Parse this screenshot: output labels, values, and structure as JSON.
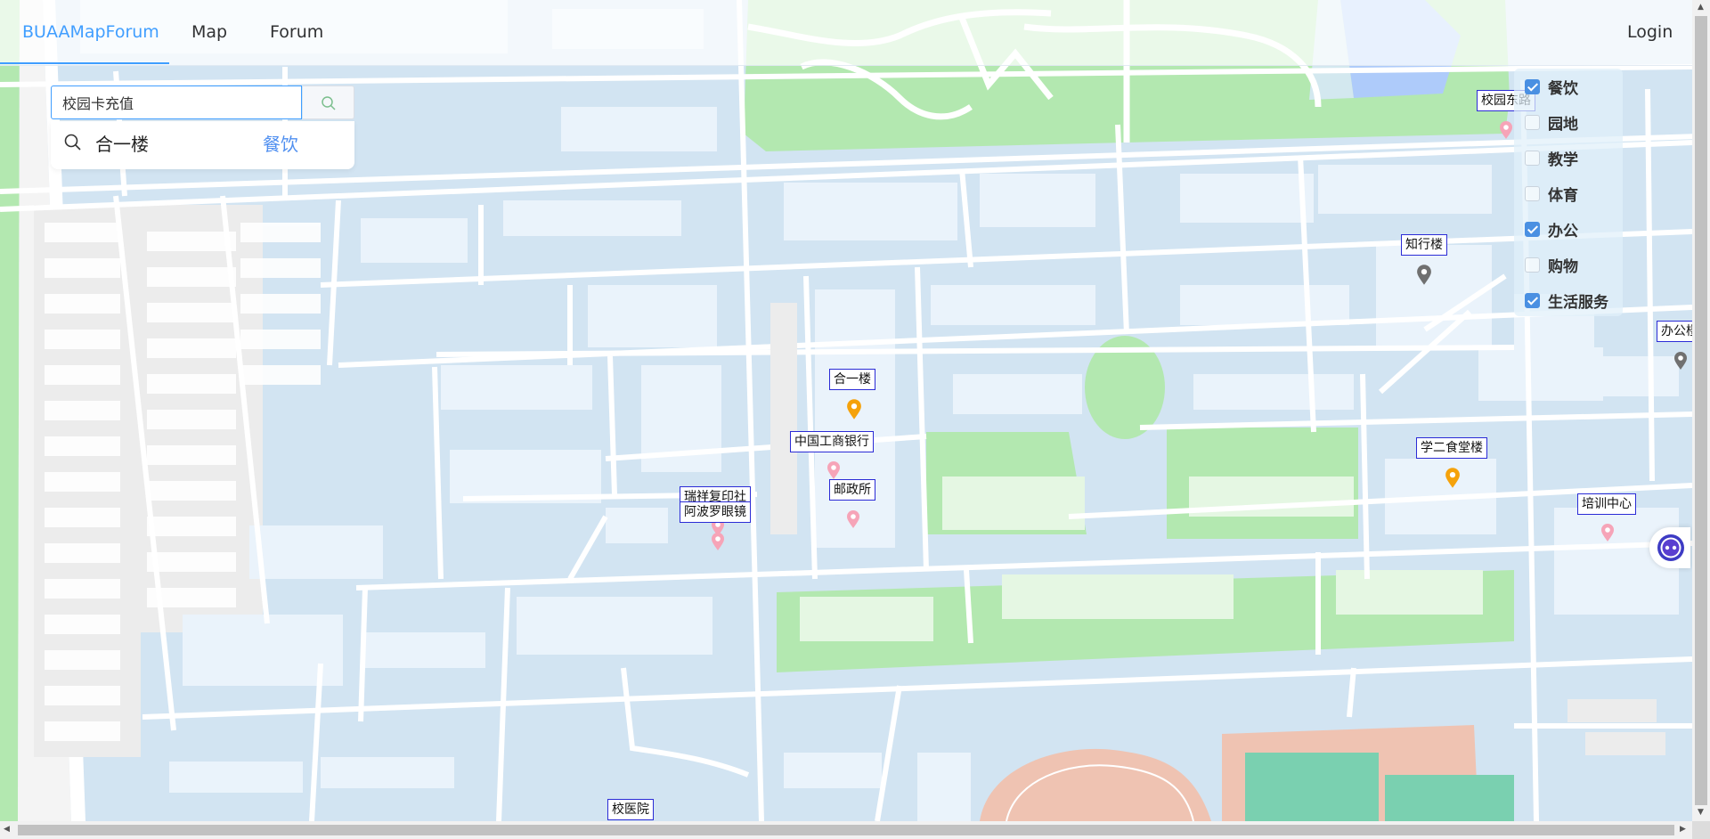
{
  "nav": {
    "brand": "BUAAMapForum",
    "map": "Map",
    "forum": "Forum",
    "login": "Login"
  },
  "search": {
    "value": "校园卡充值",
    "suggestion": {
      "name": "合一楼",
      "category": "餐饮"
    }
  },
  "filters": [
    {
      "label": "餐饮",
      "checked": true
    },
    {
      "label": "园地",
      "checked": false
    },
    {
      "label": "教学",
      "checked": false
    },
    {
      "label": "体育",
      "checked": false
    },
    {
      "label": "办公",
      "checked": true
    },
    {
      "label": "购物",
      "checked": false
    },
    {
      "label": "生活服务",
      "checked": true
    }
  ],
  "places": {
    "xiaoyuan_donglu": "校园东路",
    "zhixinglou": "知行楼",
    "bangong": "办公楼",
    "heyilou": "合一楼",
    "icbc": "中国工商银行",
    "youzhengsuo": "邮政所",
    "ruixiang": "瑞祥复印社",
    "abolo": "阿波罗眼镜",
    "xueer": "学二食堂楼",
    "peixun": "培训中心",
    "xiaoyiyuan": "校医院"
  },
  "colors": {
    "accent": "#409eff",
    "marker_dining": "#f5a20b",
    "marker_service": "#f6a4b8",
    "marker_office": "#707070",
    "label_border": "#2b2bd6"
  }
}
